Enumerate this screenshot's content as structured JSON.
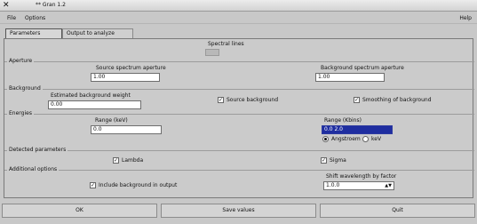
{
  "window": {
    "title": "** Gran 1.2",
    "close_glyph": "✕"
  },
  "menu": {
    "file": "File",
    "options": "Options",
    "help": "Help"
  },
  "tabs": [
    {
      "label": "Parameters",
      "active": true
    },
    {
      "label": "Output to analyze",
      "active": false
    }
  ],
  "spectral": {
    "label": "Spectral lines",
    "value": ""
  },
  "aperture": {
    "group": "Aperture",
    "source_label": "Source spectrum aperture",
    "source_value": "1.00",
    "background_label": "Background spectrum aperture",
    "background_value": "1.00"
  },
  "background": {
    "group": "Background",
    "estimated_label": "Estimated background weight",
    "estimated_value": "0.00",
    "source_background_label": "Source background",
    "source_background_checked": true,
    "smoothing_label": "Smoothing of background",
    "smoothing_checked": true
  },
  "energies": {
    "group": "Energies",
    "range_label": "Range (keV)",
    "range_value": "0.0",
    "range2_label": "Range (Kbins)",
    "range2_value": "0.0  2.0",
    "radio_angstrom": "Angstroem",
    "radio_angstrom_on": true,
    "radio_kev": "keV",
    "radio_kev_on": false
  },
  "detected": {
    "group": "Detected parameters",
    "lambda_label": "Lambda",
    "lambda_checked": true,
    "sigma_label": "Sigma",
    "sigma_checked": true
  },
  "additional": {
    "group": "Additional options",
    "include_label": "Include background in output",
    "include_checked": true,
    "shift_label": "Shift wavelength by factor",
    "shift_value": "1.0.0"
  },
  "footer": {
    "ok": "OK",
    "save": "Save values",
    "quit": "Quit"
  }
}
